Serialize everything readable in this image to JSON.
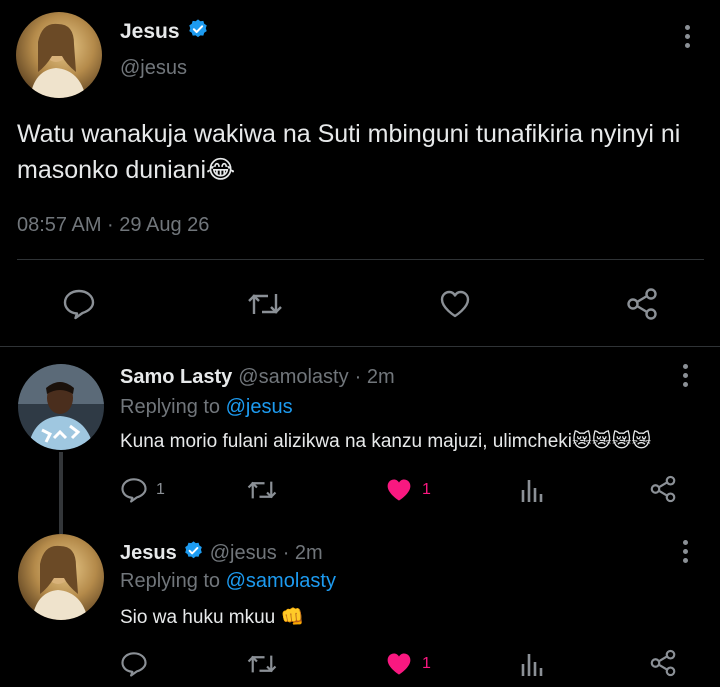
{
  "main_tweet": {
    "author_name": "Jesus",
    "author_handle": "@jesus",
    "text": "Watu wanakuja wakiwa na Suti mbinguni tunafikiria nyinyi ni masonko duniani😂",
    "timestamp": "08:57 AM · 29 Aug 26",
    "icons": [
      "reply-icon",
      "retweet-icon",
      "like-icon",
      "share-icon"
    ]
  },
  "replies": [
    {
      "author_name": "Samo Lasty",
      "author_handle": "@samolasty",
      "age": "· 2m",
      "replying_label": "Replying to",
      "replying_to": "@jesus",
      "text": "Kuna morio fulani alizikwa na kanzu  majuzi, ulimcheki😿😿😿😿",
      "reply_count": "1",
      "like_count": "1",
      "verified": false
    },
    {
      "author_name": "Jesus",
      "author_handle": "@jesus",
      "age": "· 2m",
      "replying_label": "Replying to",
      "replying_to": "@samolasty",
      "text": "Sio wa huku mkuu 👊",
      "reply_count": "",
      "like_count": "1",
      "verified": true
    }
  ],
  "colors": {
    "background": "#000000",
    "text": "#e7e9ea",
    "muted": "#71767b",
    "link": "#1d9bf0",
    "like": "#f91880",
    "verified": "#1d9bf0"
  }
}
